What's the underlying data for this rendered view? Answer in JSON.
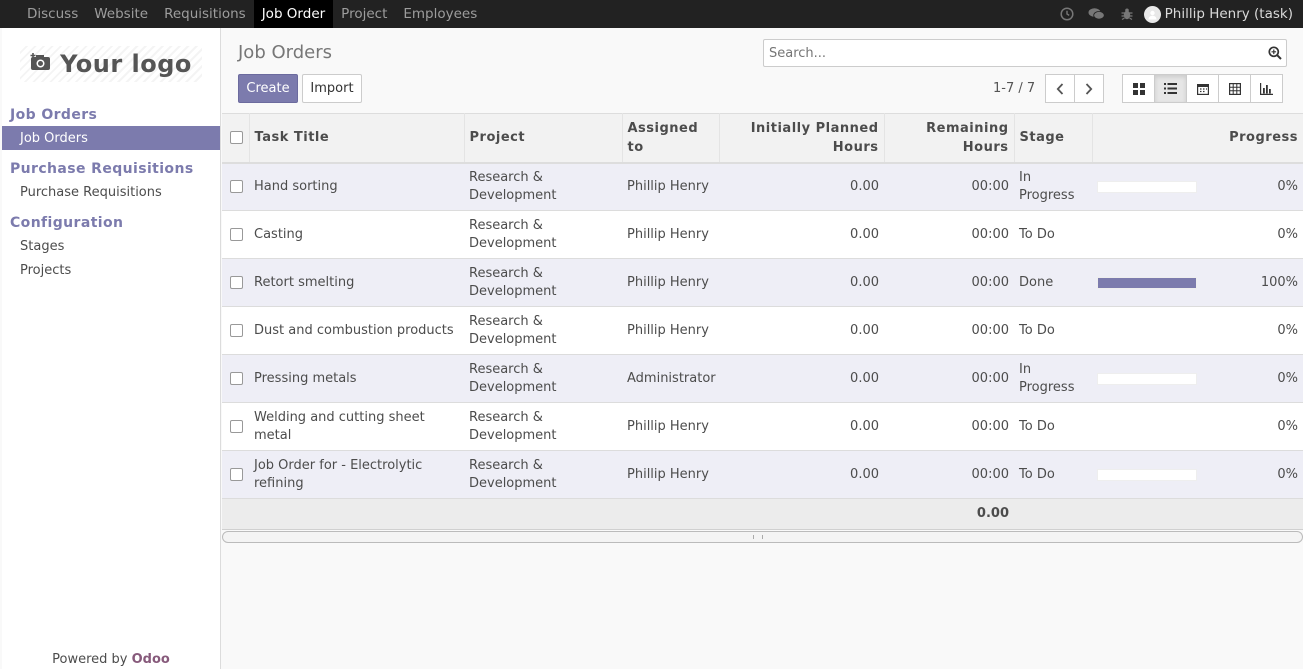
{
  "topbar": {
    "menu": [
      "Discuss",
      "Website",
      "Requisitions",
      "Job Order",
      "Project",
      "Employees"
    ],
    "active": "Job Order",
    "icons": [
      "clock-icon",
      "chat-icon",
      "bug-icon"
    ],
    "user": "Phillip Henry (task)"
  },
  "sidebar": {
    "logo_text": "Your logo",
    "sections": [
      {
        "title": "Job Orders",
        "items": [
          {
            "label": "Job Orders",
            "active": true
          }
        ]
      },
      {
        "title": "Purchase Requisitions",
        "items": [
          {
            "label": "Purchase Requisitions",
            "active": false
          }
        ]
      },
      {
        "title": "Configuration",
        "items": [
          {
            "label": "Stages",
            "active": false
          },
          {
            "label": "Projects",
            "active": false
          }
        ]
      }
    ],
    "powered_prefix": "Powered by",
    "powered_brand": "Odoo"
  },
  "main": {
    "title": "Job Orders",
    "search_placeholder": "Search...",
    "create_label": "Create",
    "import_label": "Import",
    "pager": "1-7 / 7",
    "views": [
      "kanban-view",
      "list-view",
      "calendar-view",
      "pivot-view",
      "graph-view"
    ],
    "active_view": "list-view"
  },
  "table": {
    "columns": [
      "Task Title",
      "Project",
      "Assigned to",
      "Initially Planned Hours",
      "Remaining Hours",
      "Stage",
      "Progress"
    ],
    "rows": [
      {
        "title": "Hand sorting",
        "project": "Research & Development",
        "assigned": "Phillip Henry",
        "planned": "0.00",
        "remaining": "00:00",
        "stage": "In Progress",
        "progress": 0,
        "progress_label": "0%",
        "bar": true
      },
      {
        "title": "Casting",
        "project": "Research & Development",
        "assigned": "Phillip Henry",
        "planned": "0.00",
        "remaining": "00:00",
        "stage": "To Do",
        "progress": 0,
        "progress_label": "0%",
        "bar": false
      },
      {
        "title": "Retort smelting",
        "project": "Research & Development",
        "assigned": "Phillip Henry",
        "planned": "0.00",
        "remaining": "00:00",
        "stage": "Done",
        "progress": 100,
        "progress_label": "100%",
        "bar": true
      },
      {
        "title": "Dust and combustion products",
        "project": "Research & Development",
        "assigned": "Phillip Henry",
        "planned": "0.00",
        "remaining": "00:00",
        "stage": "To Do",
        "progress": 0,
        "progress_label": "0%",
        "bar": false
      },
      {
        "title": "Pressing metals",
        "project": "Research & Development",
        "assigned": "Administrator",
        "planned": "0.00",
        "remaining": "00:00",
        "stage": "In Progress",
        "progress": 0,
        "progress_label": "0%",
        "bar": true
      },
      {
        "title": "Welding and cutting sheet metal",
        "project": "Research & Development",
        "assigned": "Phillip Henry",
        "planned": "0.00",
        "remaining": "00:00",
        "stage": "To Do",
        "progress": 0,
        "progress_label": "0%",
        "bar": false
      },
      {
        "title": "Job Order for - Electrolytic refining",
        "project": "Research & Development",
        "assigned": "Phillip Henry",
        "planned": "0.00",
        "remaining": "00:00",
        "stage": "To Do",
        "progress": 0,
        "progress_label": "0%",
        "bar": true
      }
    ],
    "total_planned": "0.00"
  },
  "colors": {
    "accent": "#7c7bad",
    "topbar": "#222222",
    "brand": "#875a7b"
  }
}
